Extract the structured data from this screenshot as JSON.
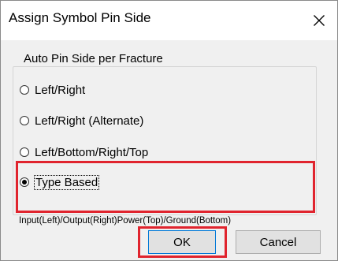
{
  "dialog": {
    "title": "Assign Symbol Pin Side",
    "close_glyph": "✕"
  },
  "group": {
    "label": "Auto Pin Side per Fracture",
    "options": [
      {
        "label": "Left/Right",
        "checked": false
      },
      {
        "label": "Left/Right (Alternate)",
        "checked": false
      },
      {
        "label": "Left/Bottom/Right/Top",
        "checked": false
      },
      {
        "label": "Type Based",
        "checked": true
      }
    ],
    "hint": "Input(Left)/Output(Right)Power(Top)/Ground(Bottom)"
  },
  "buttons": {
    "ok": "OK",
    "cancel": "Cancel"
  },
  "colors": {
    "highlight": "#e0242e",
    "focus": "#0078d7"
  }
}
